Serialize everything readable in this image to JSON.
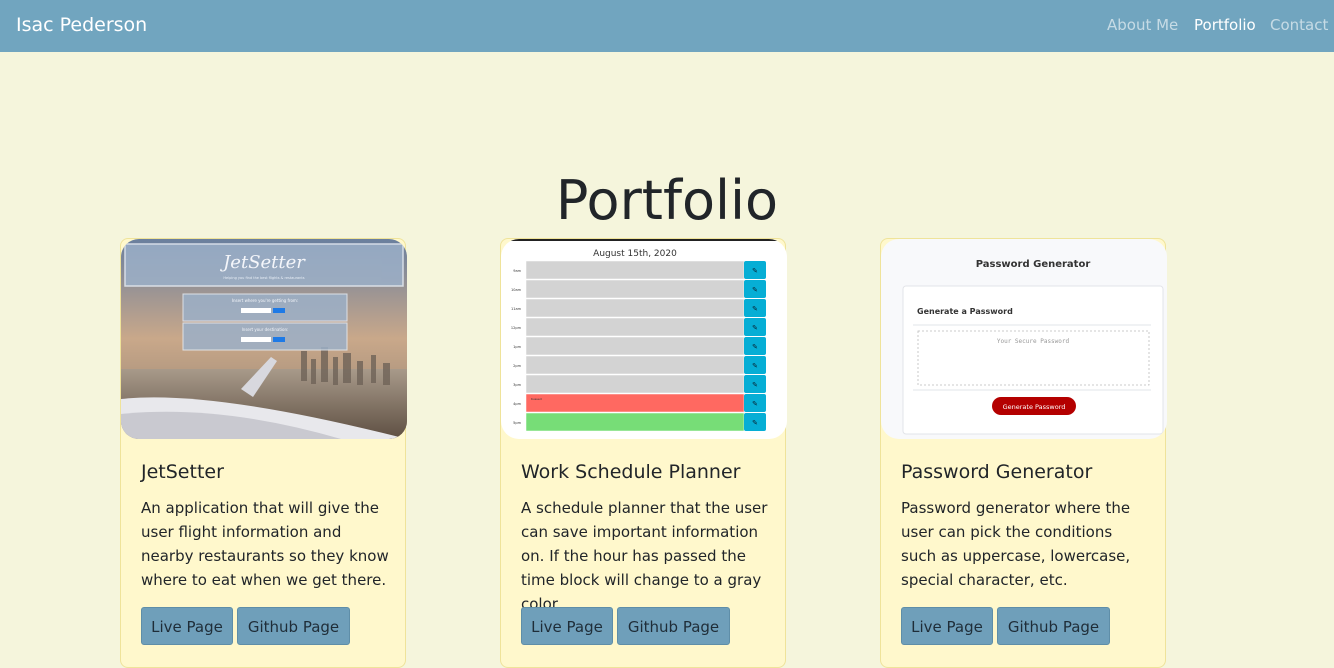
{
  "navbar": {
    "brand": "Isac Pederson",
    "links": [
      {
        "label": "About Me",
        "active": false
      },
      {
        "label": "Portfolio",
        "active": true
      },
      {
        "label": "Contact",
        "active": false
      }
    ]
  },
  "page": {
    "title": "Portfolio"
  },
  "cards": [
    {
      "title": "JetSetter",
      "text": "An application that will give the user flight information and nearby restaurants so they know where to eat when we get there.",
      "live_label": "Live Page",
      "github_label": "Github Page",
      "preview": {
        "logo": "JetSetter",
        "tagline": "Helping you find the best flights & restaurants",
        "prompt1": "Insert where you're getting from:",
        "prompt2": "Insert your destination:"
      }
    },
    {
      "title": "Work Schedule Planner",
      "text": "A schedule planner that the user can save important information on. If the hour has passed the time block will change to a gray color.",
      "live_label": "Live Page",
      "github_label": "Github Page",
      "preview": {
        "date": "August 15th, 2020",
        "hours": [
          "9am",
          "10am",
          "11am",
          "12pm",
          "1pm",
          "2pm",
          "3pm",
          "4pm",
          "5pm"
        ],
        "note": "Kussed"
      }
    },
    {
      "title": "Password Generator",
      "text": "Password generator where the user can pick the conditions such as uppercase, lowercase, special character, etc.",
      "live_label": "Live Page",
      "github_label": "Github Page",
      "preview": {
        "header": "Password Generator",
        "subheader": "Generate a Password",
        "placeholder": "Your Secure Password",
        "button": "Generate Password"
      }
    }
  ],
  "colors": {
    "navbar": "#71a5bf",
    "background": "#f5f5dc",
    "card": "#fff8cc",
    "button": "#6f9fba",
    "past_block": "#d3d3d3",
    "present_block": "#ff6961",
    "future_block": "#77dd77",
    "save_button": "#06aed5",
    "generate_button": "#b40000"
  }
}
